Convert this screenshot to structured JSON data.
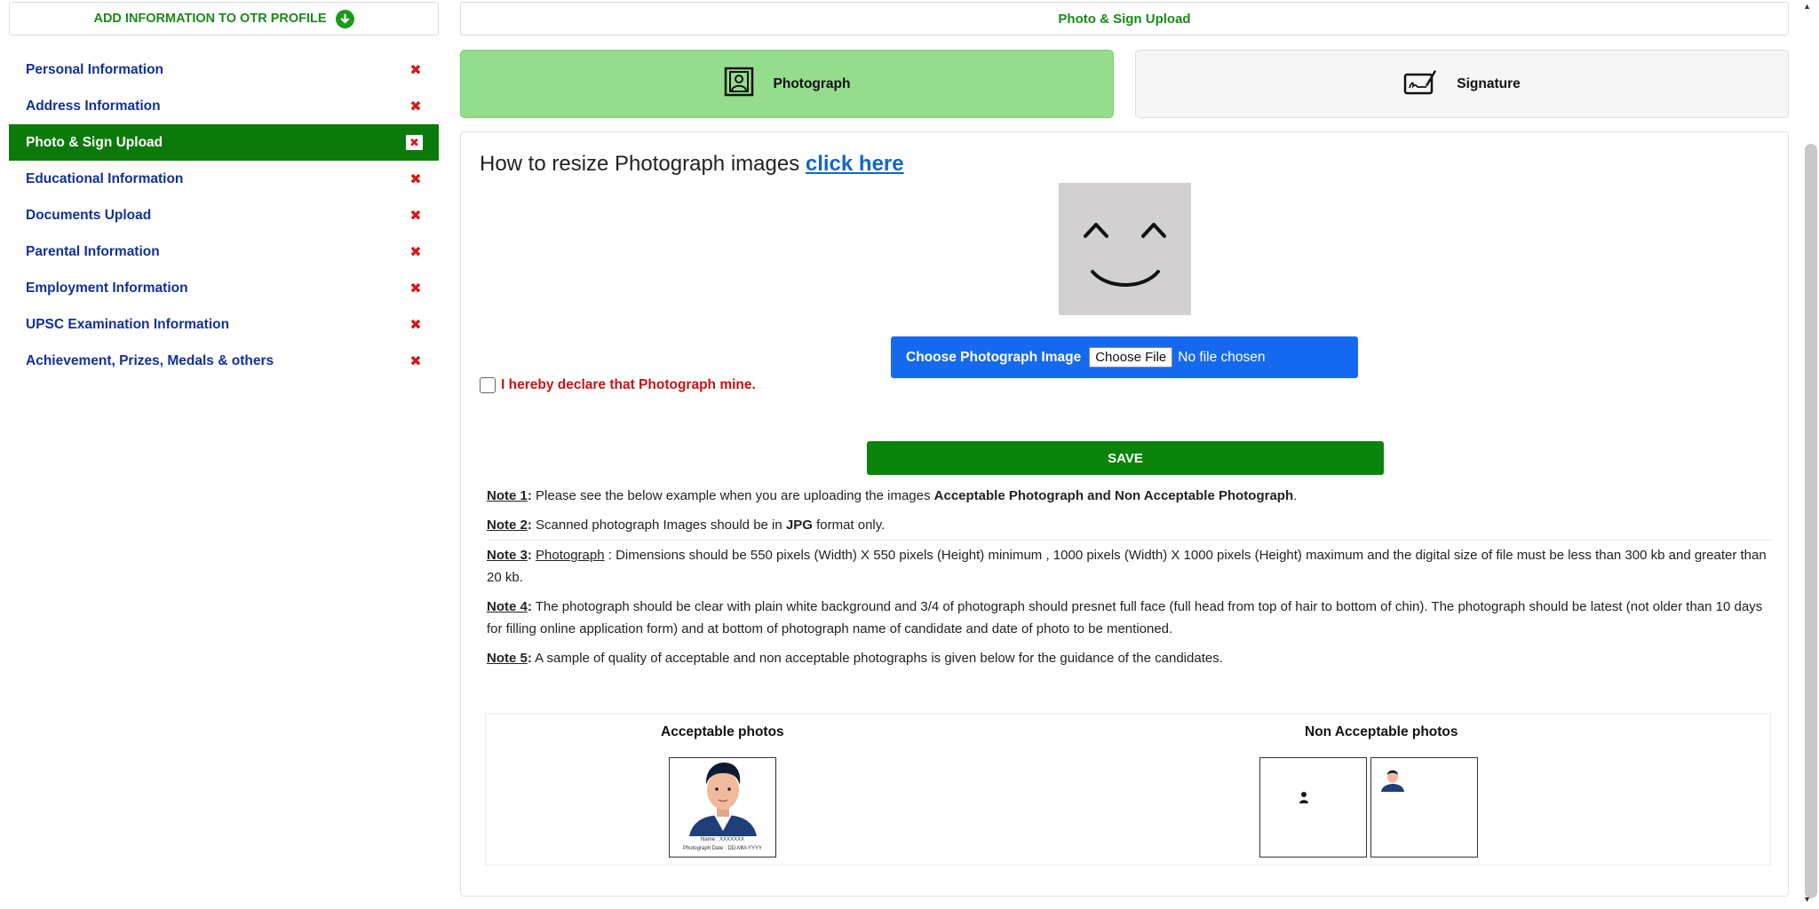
{
  "sidebar": {
    "header": "ADD INFORMATION TO OTR PROFILE",
    "header_icon": "arrow-down-circle-icon",
    "items": [
      {
        "label": "Personal Information",
        "status": "✖"
      },
      {
        "label": "Address Information",
        "status": "✖"
      },
      {
        "label": "Photo & Sign Upload",
        "status": "✖"
      },
      {
        "label": "Educational Information",
        "status": "✖"
      },
      {
        "label": "Documents Upload",
        "status": "✖"
      },
      {
        "label": "Parental Information",
        "status": "✖"
      },
      {
        "label": "Employment Information",
        "status": "✖"
      },
      {
        "label": "UPSC Examination Information",
        "status": "✖"
      },
      {
        "label": "Achievement, Prizes, Medals & others",
        "status": "✖"
      }
    ],
    "active_index": 2
  },
  "header": {
    "title": "Photo & Sign Upload"
  },
  "tabs": {
    "photo": "Photograph",
    "signature": "Signature"
  },
  "resize": {
    "text": "How to resize Photograph images ",
    "link": "click here"
  },
  "upload": {
    "label": "Choose Photograph Image",
    "button": "Choose File",
    "status": "No file chosen"
  },
  "declaration": "I hereby declare that Photograph mine.",
  "save_label": "SAVE",
  "notes": {
    "n1": {
      "label": "Note 1",
      "text": " Please see the below example when you are uploading the images ",
      "bold": "Acceptable Photograph and Non Acceptable Photograph",
      "end": "."
    },
    "n2": {
      "label": "Note 2",
      "text": " Scanned photograph Images should be in ",
      "bold": "JPG",
      "end": " format only."
    },
    "n3": {
      "label": "Note 3",
      "term": "Photograph",
      "text": " : Dimensions should be 550 pixels (Width) X 550 pixels (Height) minimum , 1000 pixels (Width) X 1000 pixels (Height) maximum and the digital size of file must be less than 300 kb and greater than 20 kb."
    },
    "n4": {
      "label": "Note 4",
      "text": " The photograph should be clear with plain white background and 3/4 of photograph should presnet full face (full head from top of hair to bottom of chin). The photograph should be latest (not older than 10 days for filling online application form) and at bottom of photograph name of candidate and date of photo to be mentioned."
    },
    "n5": {
      "label": "Note 5",
      "text": " A sample of quality of acceptable and non acceptable photographs is given below for the guidance of the candidates."
    }
  },
  "samples": {
    "acceptable_title": "Acceptable photos",
    "non_acceptable_title": "Non Acceptable photos",
    "caption_name": "Name : XXXXXXX",
    "caption_date": "Photograph Date : DD-MM-YYYY"
  },
  "colors": {
    "active_green": "#0b7a0b",
    "tab_green": "#95dc8d",
    "nav_blue": "#12309a",
    "status_red": "#d11b1b",
    "upload_blue": "#1569ee",
    "save_green": "#0a840a"
  }
}
